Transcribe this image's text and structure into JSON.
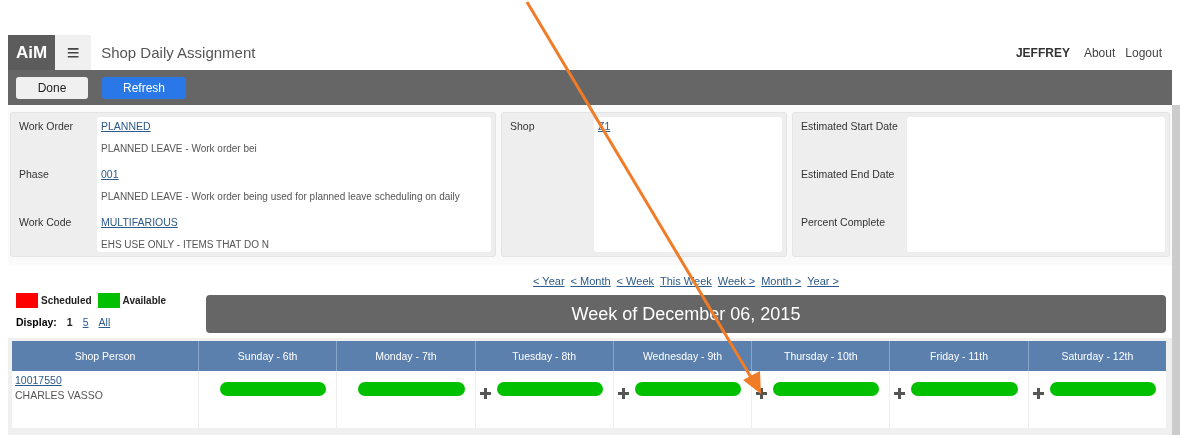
{
  "header": {
    "logo": "AiM",
    "menu_glyph": "≡",
    "title": "Shop Daily Assignment",
    "user": "JEFFREY",
    "links": [
      "About",
      "Logout"
    ]
  },
  "toolbar": {
    "buttons": [
      {
        "label": "Done",
        "kind": "plain"
      },
      {
        "label": "Refresh",
        "kind": "primary"
      }
    ]
  },
  "panels": [
    {
      "fields": [
        {
          "label": "Work Order",
          "value": "PLANNED",
          "description": "PLANNED LEAVE - Work order bei"
        },
        {
          "label": "Phase",
          "value": "001",
          "description": "PLANNED LEAVE - Work order being used for planned leave scheduling on daily"
        },
        {
          "label": "Work Code",
          "value": "MULTIFARIOUS",
          "description": "EHS USE ONLY - ITEMS THAT DO N"
        }
      ]
    },
    {
      "fields": [
        {
          "label": "Shop",
          "value": "Z1"
        }
      ]
    },
    {
      "fields": [
        {
          "label": "Estimated Start Date"
        },
        {
          "label": "Estimated End Date"
        },
        {
          "label": "Percent Complete"
        }
      ]
    }
  ],
  "legend": [
    {
      "label": "Scheduled",
      "color": "#ff0000"
    },
    {
      "label": "Available",
      "color": "#00c000"
    }
  ],
  "display": {
    "label": "Display:",
    "options": [
      {
        "label": "1",
        "selected": true
      },
      {
        "label": "5",
        "selected": false
      },
      {
        "label": "All",
        "selected": false
      }
    ]
  },
  "nav_links": [
    "< Year",
    "< Month",
    "< Week",
    "This Week",
    "Week >",
    "Month >",
    "Year >"
  ],
  "week_title": "Week of December 06, 2015",
  "table": {
    "person_column": "Shop Person",
    "days": [
      {
        "label": "Sunday - 6th"
      },
      {
        "label": "Monday - 7th"
      },
      {
        "label": "Tuesday - 8th"
      },
      {
        "label": "Wednesday - 9th"
      },
      {
        "label": "Thursday - 10th"
      },
      {
        "label": "Friday - 11th"
      },
      {
        "label": "Saturday - 12th"
      }
    ],
    "rows": [
      {
        "id": "10017550",
        "name": "CHARLES VASSO",
        "cells": [
          {
            "add": false,
            "color": "#00c000"
          },
          {
            "add": false,
            "color": "#00c000"
          },
          {
            "add": true,
            "color": "#00c000"
          },
          {
            "add": true,
            "color": "#00c000"
          },
          {
            "add": true,
            "color": "#00c000"
          },
          {
            "add": true,
            "color": "#00c000"
          },
          {
            "add": true,
            "color": "#00c000"
          }
        ]
      }
    ]
  }
}
